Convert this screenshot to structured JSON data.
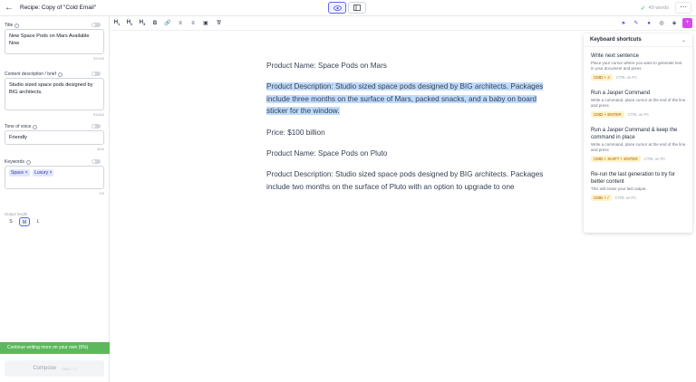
{
  "header": {
    "title": "Recipe: Copy of \"Cold Email\"",
    "word_count": "49 words"
  },
  "toolbar": {
    "buttons": [
      "H1",
      "H2",
      "H3",
      "B",
      "link",
      "ul",
      "ol",
      "img",
      "clear"
    ]
  },
  "left_panel": {
    "title_label": "Title",
    "title_value": "New Space Pods on Mars Available Now",
    "title_counter": "37/100",
    "desc_label": "Content description / brief",
    "desc_value": "Studio sized space pods designed by BIG architects.",
    "desc_counter": "51/400",
    "tone_label": "Tone of voice",
    "tone_value": "Friendly",
    "tone_counter": "8/40",
    "keywords_label": "Keywords",
    "keywords": [
      "Space",
      "Luxury"
    ],
    "keywords_counter": "2/3",
    "output_length_label": "Output length",
    "lengths": [
      "S",
      "M",
      "L"
    ],
    "selected_length": "M",
    "continue_label": "Continue writing more on your own (5%)",
    "compose_label": "Compose",
    "compose_shortcut": "CMD + J"
  },
  "document": {
    "p1": "Product Name: Space Pods on Mars",
    "p2": "Product Description: Studio sized space pods designed by BIG architects.  Packages include three months on the surface of Mars, packed snacks, and a baby on board sticker for the window.",
    "p3": "Price: $100 billion",
    "p4": "Product Name: Space Pods on Pluto",
    "p5": "Product Description: Studio sized space pods designed by BIG architects. Packages include two months on the surface of Pluto with an option to upgrade to one"
  },
  "shortcuts": {
    "title": "Keyboard shortcuts",
    "items": [
      {
        "name": "Write next sentence",
        "desc": "Place your cursor where you want to generate text in your document and press",
        "key": "CMD + J",
        "pc": "CTRL on PC"
      },
      {
        "name": "Run a Jasper Command",
        "desc": "Write a command, place cursor at the end of the line and press",
        "key": "CMD + ENTER",
        "pc": "CTRL on PC"
      },
      {
        "name": "Run a Jasper Command & keep the command in place",
        "desc": "Write a command, place cursor at the end of the line and press",
        "key": "CMD + SHIFT + ENTER",
        "pc": "CTRL on PC"
      },
      {
        "name": "Re-run the last generation to try for better content",
        "desc": "This will erase your last output.",
        "key": "CMD + /",
        "pc": "CTRL on PC"
      }
    ]
  }
}
